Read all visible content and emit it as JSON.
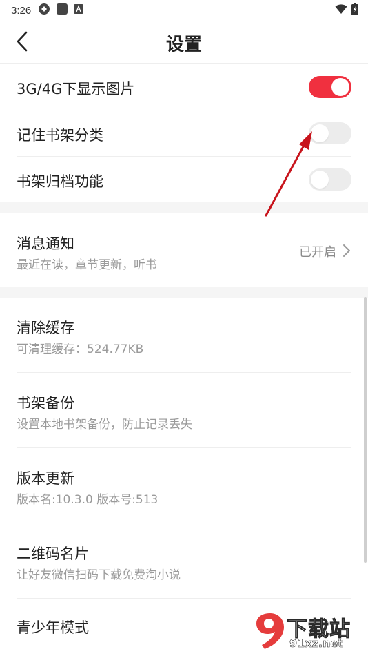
{
  "status_bar": {
    "time": "3:26"
  },
  "nav": {
    "title": "设置"
  },
  "toggles": [
    {
      "label": "3G/4G下显示图片",
      "on": true
    },
    {
      "label": "记住书架分类",
      "on": false
    },
    {
      "label": "书架归档功能",
      "on": false
    }
  ],
  "notification": {
    "label": "消息通知",
    "subtitle": "最近在读，章节更新，听书",
    "value": "已开启"
  },
  "items": [
    {
      "label": "清除缓存",
      "subtitle": "可清理缓存：524.77KB"
    },
    {
      "label": "书架备份",
      "subtitle": "设置本地书架备份，防止记录丢失"
    },
    {
      "label": "版本更新",
      "subtitle": "版本名:10.3.0  版本号:513"
    },
    {
      "label": "二维码名片",
      "subtitle": "让好友微信扫码下载免费淘小说"
    },
    {
      "label": "青少年模式"
    }
  ],
  "colors": {
    "accent": "#f0303f",
    "annotation_arrow": "#c8141c"
  },
  "watermark": {
    "text": "下载站",
    "url": "91xz.net"
  }
}
